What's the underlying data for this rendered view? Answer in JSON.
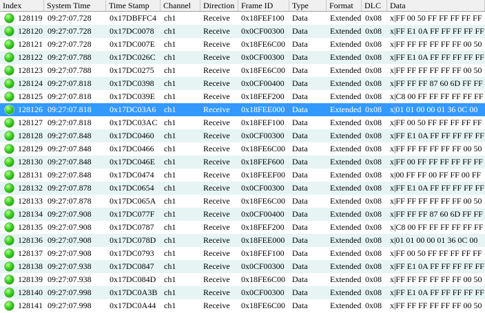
{
  "columns": [
    "Index",
    "System Time",
    "Time Stamp",
    "Channel",
    "Direction",
    "Frame ID",
    "Type",
    "Format",
    "DLC",
    "Data"
  ],
  "status_icon": "green-status-dot-icon",
  "colors": {
    "row_alt": "#e6f4f4",
    "row_selected": "#3399ff",
    "status_green": "#2fc414"
  },
  "selected_index": "128126",
  "rows": [
    [
      "128119",
      "09:27:07.728",
      "0x17DBFFC4",
      "ch1",
      "Receive",
      "0x18FEF100",
      "Data",
      "Extended",
      "0x08",
      "x|FF 00 50 FF FF FF FF FF"
    ],
    [
      "128120",
      "09:27:07.728",
      "0x17DC0078",
      "ch1",
      "Receive",
      "0x0CF00300",
      "Data",
      "Extended",
      "0x08",
      "x|FF E1 0A FF FF FF FF FF"
    ],
    [
      "128121",
      "09:27:07.728",
      "0x17DC007E",
      "ch1",
      "Receive",
      "0x18FE6C00",
      "Data",
      "Extended",
      "0x08",
      "x|FF FF FF FF FF FF 00 50"
    ],
    [
      "128122",
      "09:27:07.788",
      "0x17DC026C",
      "ch1",
      "Receive",
      "0x0CF00300",
      "Data",
      "Extended",
      "0x08",
      "x|FF E1 0A FF FF FF FF FF"
    ],
    [
      "128123",
      "09:27:07.788",
      "0x17DC0275",
      "ch1",
      "Receive",
      "0x18FE6C00",
      "Data",
      "Extended",
      "0x08",
      "x|FF FF FF FF FF FF 00 50"
    ],
    [
      "128124",
      "09:27:07.818",
      "0x17DC0398",
      "ch1",
      "Receive",
      "0x0CF00400",
      "Data",
      "Extended",
      "0x08",
      "x|FF FF FF 87 60 6D FF FF"
    ],
    [
      "128125",
      "09:27:07.818",
      "0x17DC039E",
      "ch1",
      "Receive",
      "0x18FEF200",
      "Data",
      "Extended",
      "0x08",
      "x|C8 00 FF FF FF FF FF FF"
    ],
    [
      "128126",
      "09:27:07.818",
      "0x17DC03A6",
      "ch1",
      "Receive",
      "0x18FEE000",
      "Data",
      "Extended",
      "0x08",
      "x|01 01 00 00 01 36 0C 00"
    ],
    [
      "128127",
      "09:27:07.818",
      "0x17DC03AC",
      "ch1",
      "Receive",
      "0x18FEF100",
      "Data",
      "Extended",
      "0x08",
      "x|FF 00 50 FF FF FF FF FF"
    ],
    [
      "128128",
      "09:27:07.848",
      "0x17DC0460",
      "ch1",
      "Receive",
      "0x0CF00300",
      "Data",
      "Extended",
      "0x08",
      "x|FF E1 0A FF FF FF FF FF"
    ],
    [
      "128129",
      "09:27:07.848",
      "0x17DC0466",
      "ch1",
      "Receive",
      "0x18FE6C00",
      "Data",
      "Extended",
      "0x08",
      "x|FF FF FF FF FF FF 00 50"
    ],
    [
      "128130",
      "09:27:07.848",
      "0x17DC046E",
      "ch1",
      "Receive",
      "0x18FEF600",
      "Data",
      "Extended",
      "0x08",
      "x|FF 00 FF FF FF FF FF FF"
    ],
    [
      "128131",
      "09:27:07.848",
      "0x17DC0474",
      "ch1",
      "Receive",
      "0x18FEEF00",
      "Data",
      "Extended",
      "0x08",
      "x|00 FF FF 00 FF FF 00 FF"
    ],
    [
      "128132",
      "09:27:07.878",
      "0x17DC0654",
      "ch1",
      "Receive",
      "0x0CF00300",
      "Data",
      "Extended",
      "0x08",
      "x|FF E1 0A FF FF FF FF FF"
    ],
    [
      "128133",
      "09:27:07.878",
      "0x17DC065A",
      "ch1",
      "Receive",
      "0x18FE6C00",
      "Data",
      "Extended",
      "0x08",
      "x|FF FF FF FF FF FF 00 50"
    ],
    [
      "128134",
      "09:27:07.908",
      "0x17DC077F",
      "ch1",
      "Receive",
      "0x0CF00400",
      "Data",
      "Extended",
      "0x08",
      "x|FF FF FF 87 60 6D FF FF"
    ],
    [
      "128135",
      "09:27:07.908",
      "0x17DC0787",
      "ch1",
      "Receive",
      "0x18FEF200",
      "Data",
      "Extended",
      "0x08",
      "x|C8 00 FF FF FF FF FF FF"
    ],
    [
      "128136",
      "09:27:07.908",
      "0x17DC078D",
      "ch1",
      "Receive",
      "0x18FEE000",
      "Data",
      "Extended",
      "0x08",
      "x|01 01 00 00 01 36 0C 00"
    ],
    [
      "128137",
      "09:27:07.908",
      "0x17DC0793",
      "ch1",
      "Receive",
      "0x18FEF100",
      "Data",
      "Extended",
      "0x08",
      "x|FF 00 50 FF FF FF FF FF"
    ],
    [
      "128138",
      "09:27:07.938",
      "0x17DC0847",
      "ch1",
      "Receive",
      "0x0CF00300",
      "Data",
      "Extended",
      "0x08",
      "x|FF E1 0A FF FF FF FF FF"
    ],
    [
      "128139",
      "09:27:07.938",
      "0x17DC084D",
      "ch1",
      "Receive",
      "0x18FE6C00",
      "Data",
      "Extended",
      "0x08",
      "x|FF FF FF FF FF FF 00 50"
    ],
    [
      "128140",
      "09:27:07.998",
      "0x17DC0A3B",
      "ch1",
      "Receive",
      "0x0CF00300",
      "Data",
      "Extended",
      "0x08",
      "x|FF E1 0A FF FF FF FF FF"
    ],
    [
      "128141",
      "09:27:07.998",
      "0x17DC0A44",
      "ch1",
      "Receive",
      "0x18FE6C00",
      "Data",
      "Extended",
      "0x08",
      "x|FF FF FF FF FF FF 00 50"
    ]
  ]
}
